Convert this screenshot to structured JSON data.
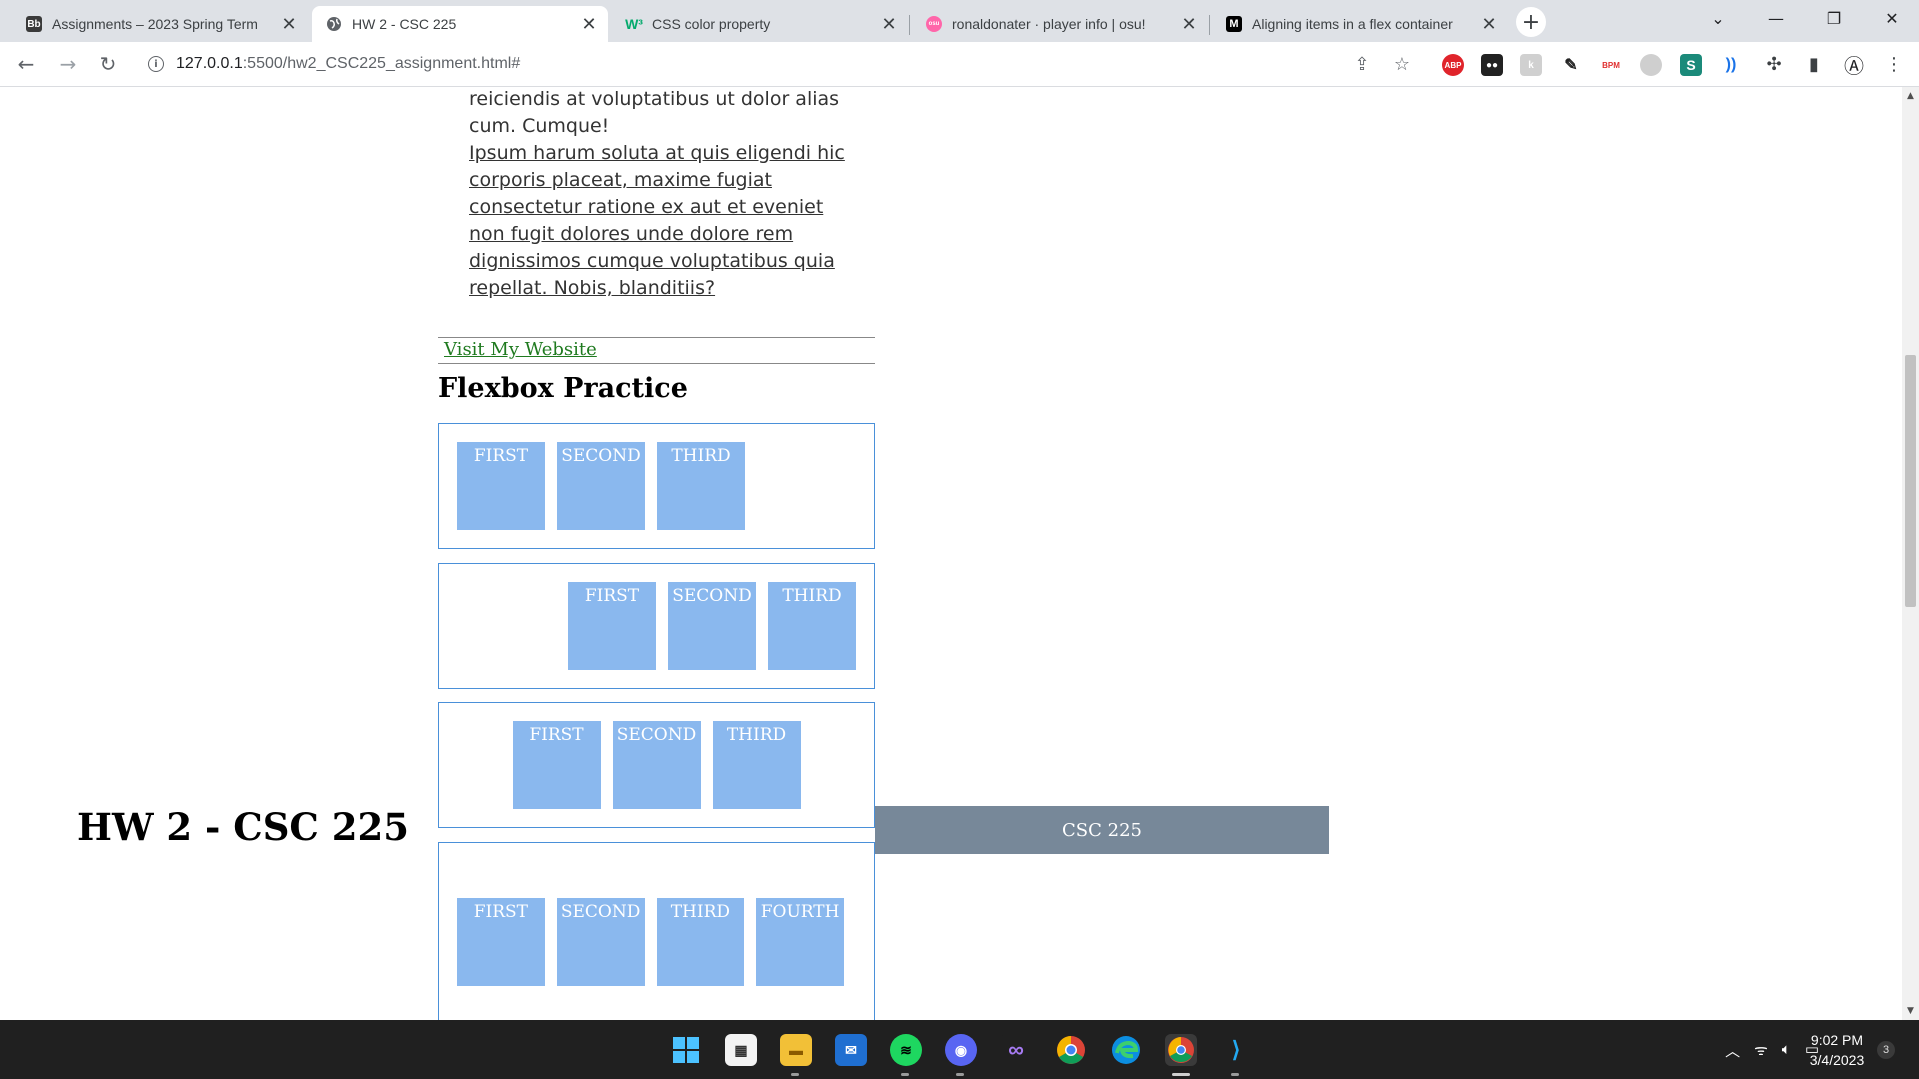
{
  "browser": {
    "tabs": [
      {
        "title": "Assignments – 2023 Spring Term",
        "favicon": "blackboard-icon",
        "active": false
      },
      {
        "title": "HW 2 - CSC 225",
        "favicon": "globe-icon",
        "active": true
      },
      {
        "title": "CSS color property",
        "favicon": "w3schools-icon",
        "active": false
      },
      {
        "title": "ronaldonater · player info | osu!",
        "favicon": "osu-icon",
        "active": false
      },
      {
        "title": "Aligning items in a flex container",
        "favicon": "mdn-icon",
        "active": false
      }
    ],
    "url_host": "127.0.0.1",
    "url_rest": ":5500/hw2_CSC225_assignment.html#",
    "extensions": [
      "ABP",
      "BPM",
      "S"
    ]
  },
  "page": {
    "paragraph_plain": "reiciendis at voluptatibus ut dolor alias cum. Cumque!",
    "paragraph_link": "Ipsum harum soluta at quis eligendi hic corporis placeat, maxime fugiat consectetur ratione ex aut et eveniet non fugit dolores unde dolore rem dignissimos cumque voluptatibus quia repellat. Nobis, blanditiis?",
    "nav_link": "Visit My Website",
    "flex_heading": "Flexbox Practice",
    "flex_containers": [
      {
        "items": [
          "FIRST",
          "SECOND",
          "THIRD"
        ]
      },
      {
        "items": [
          "FIRST",
          "SECOND",
          "THIRD"
        ]
      },
      {
        "items": [
          "FIRST",
          "SECOND",
          "THIRD"
        ]
      },
      {
        "items": [
          "FIRST",
          "SECOND",
          "THIRD",
          "FOURTH"
        ]
      }
    ],
    "hw_title": "HW 2 - CSC 225",
    "footer_text": "CSC 225"
  },
  "taskbar": {
    "time": "9:02 PM",
    "date": "3/4/2023",
    "notifications": "3"
  },
  "colors": {
    "flex_box": "#8ab8ee",
    "flex_border": "#4a90d9",
    "footer_bar": "#778899",
    "nav_link": "#1f7a1f"
  }
}
